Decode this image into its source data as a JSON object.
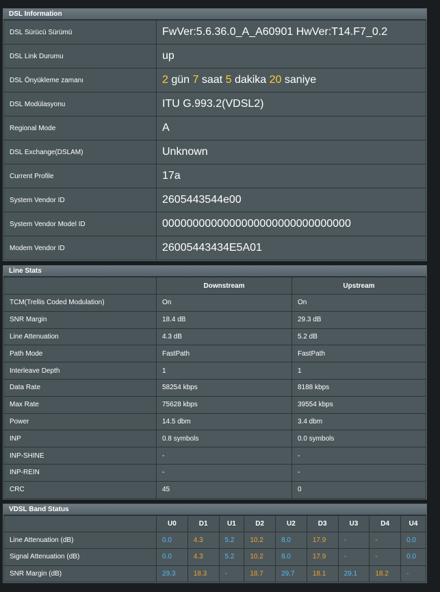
{
  "dsl_info": {
    "title": "DSL Information",
    "rows": [
      {
        "label": "DSL Sürücü Sürümü",
        "value": "FwVer:5.6.36.0_A_A60901 HwVer:T14.F7_0.2"
      },
      {
        "label": "DSL Link Durumu",
        "value": "up"
      },
      {
        "label": "DSL Önyükleme zamanı",
        "uptime": {
          "days": "2",
          "days_unit": "gün",
          "hours": "7",
          "hours_unit": "saat",
          "minutes": "5",
          "minutes_unit": "dakika",
          "seconds": "20",
          "seconds_unit": "saniye"
        }
      },
      {
        "label": "DSL Modülasyonu",
        "value": "ITU G.993.2(VDSL2)"
      },
      {
        "label": "Regional Mode",
        "value": "A"
      },
      {
        "label": "DSL Exchange(DSLAM)",
        "value": "Unknown"
      },
      {
        "label": "Current Profile",
        "value": "17a"
      },
      {
        "label": "System Vendor ID",
        "value": "2605443544e00"
      },
      {
        "label": "System Vendor Model ID",
        "value": "0000000000000000000000000000000"
      },
      {
        "label": "Modem Vendor ID",
        "value": "26005443434E5A01"
      }
    ]
  },
  "line_stats": {
    "title": "Line Stats",
    "headers": [
      "Downstream",
      "Upstream"
    ],
    "rows": [
      {
        "label": "TCM(Trellis Coded Modulation)",
        "down": "On",
        "up": "On"
      },
      {
        "label": "SNR Margin",
        "down": "18.4 dB",
        "up": "29.3 dB"
      },
      {
        "label": "Line Attenuation",
        "down": "4.3 dB",
        "up": "5.2 dB"
      },
      {
        "label": "Path Mode",
        "down": "FastPath",
        "up": "FastPath"
      },
      {
        "label": "Interleave Depth",
        "down": "1",
        "up": "1"
      },
      {
        "label": "Data Rate",
        "down": "58254 kbps",
        "up": "8188 kbps"
      },
      {
        "label": "Max Rate",
        "down": "75628 kbps",
        "up": "39554 kbps"
      },
      {
        "label": "Power",
        "down": "14.5 dbm",
        "up": "3.4 dbm"
      },
      {
        "label": "INP",
        "down": "0.8 symbols",
        "up": "0.0 symbols"
      },
      {
        "label": "INP-SHINE",
        "down": "-",
        "up": "-"
      },
      {
        "label": "INP-REIN",
        "down": "-",
        "up": "-"
      },
      {
        "label": "CRC",
        "down": "45",
        "up": "0"
      }
    ]
  },
  "vdsl_band": {
    "title": "VDSL Band Status",
    "bands": [
      "U0",
      "D1",
      "U1",
      "D2",
      "U2",
      "D3",
      "U3",
      "D4",
      "U4"
    ],
    "rows": [
      {
        "label": "Line Attenuation (dB)",
        "values": [
          "0.0",
          "4.3",
          "5.2",
          "10.2",
          "8.0",
          "17.9",
          "-",
          "-",
          "0.0"
        ]
      },
      {
        "label": "Signal Attenuation (dB)",
        "values": [
          "0.0",
          "4.3",
          "5.2",
          "10.2",
          "8.0",
          "17.9",
          "-",
          "-",
          "0.0"
        ]
      },
      {
        "label": "SNR Margin (dB)",
        "values": [
          "29.3",
          "18.3",
          "-",
          "18.7",
          "29.7",
          "18.1",
          "29.1",
          "18.2",
          "-"
        ]
      }
    ],
    "colors": {
      "up": "#55b8f0",
      "down": "#f0a030"
    }
  }
}
